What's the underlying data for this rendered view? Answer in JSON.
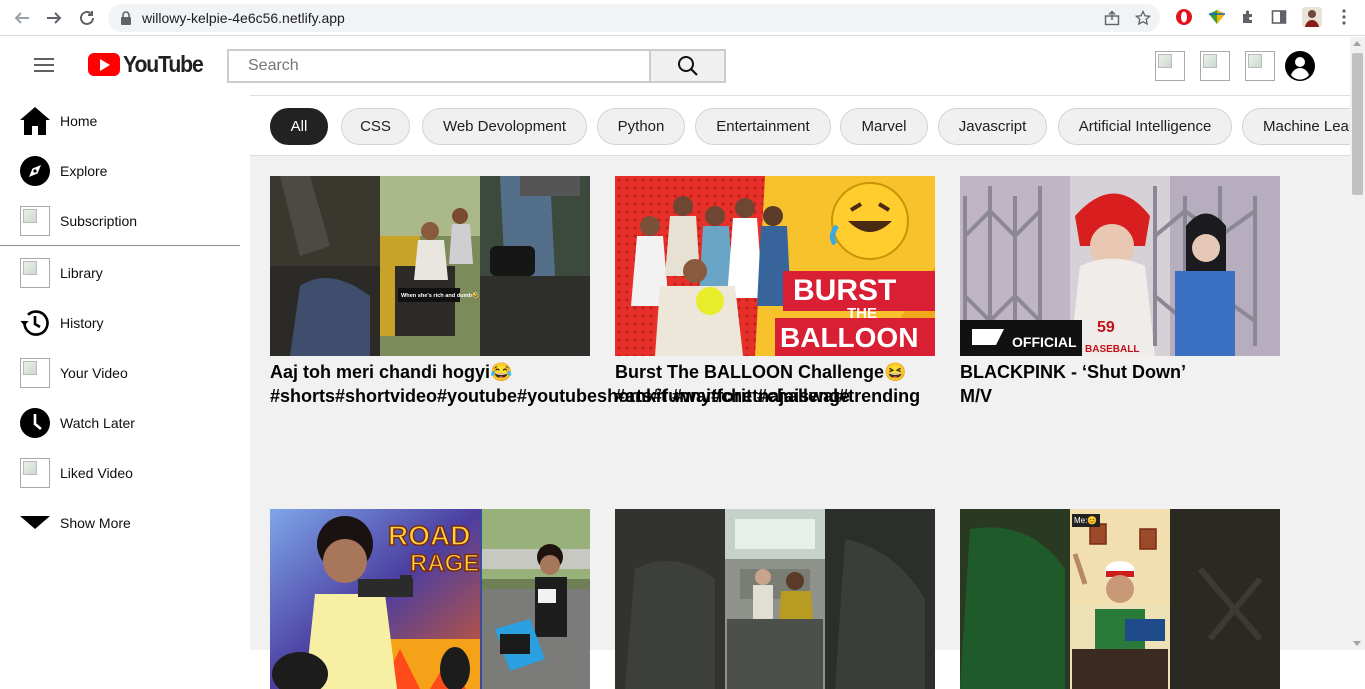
{
  "browser": {
    "url": "willowy-kelpie-4e6c56.netlify.app"
  },
  "header": {
    "logo_text": "YouTube",
    "search_placeholder": "Search"
  },
  "sidebar": {
    "items": [
      {
        "label": "Home",
        "icon": "home-icon"
      },
      {
        "label": "Explore",
        "icon": "compass-icon"
      },
      {
        "label": "Subscription",
        "icon": "broken-image-icon"
      },
      {
        "label": "Library",
        "icon": "broken-image-icon"
      },
      {
        "label": "History",
        "icon": "history-icon"
      },
      {
        "label": "Your Video",
        "icon": "broken-image-icon"
      },
      {
        "label": "Watch Later",
        "icon": "clock-icon"
      },
      {
        "label": "Liked Video",
        "icon": "broken-image-icon"
      },
      {
        "label": "Show More",
        "icon": "caret-down-icon"
      }
    ]
  },
  "chips": [
    "All",
    "CSS",
    "Web Devolopment",
    "Python",
    "Entertainment",
    "Marvel",
    "Javascript",
    "Artificial Intelligence",
    "Machine Learning"
  ],
  "videos": [
    {
      "title": "Aaj toh meri chandi hogyi😂 #shorts#shortvideo#youtube#youtubeshorts#funny#chetnajaiswal#trending"
    },
    {
      "title": "Burst The BALLOON Challenge😆 #ankit #waitforit #challenge"
    },
    {
      "title": "BLACKPINK - ‘Shut Down’ M/V"
    },
    {
      "title": ""
    },
    {
      "title": ""
    },
    {
      "title": ""
    }
  ],
  "thumb_text": {
    "v1_caption": "When she's rich and dumb🤣",
    "v2_line1": "BURST",
    "v2_line2": "THE",
    "v2_line3": "BALLOON",
    "v3_badge": "OFFICIAL",
    "v3_jersey": "59",
    "v3_jersey_word": "BASEBALL",
    "v4_line1": "ROAD",
    "v4_line2": "RAGE",
    "v6_caption": "Me:😊"
  }
}
